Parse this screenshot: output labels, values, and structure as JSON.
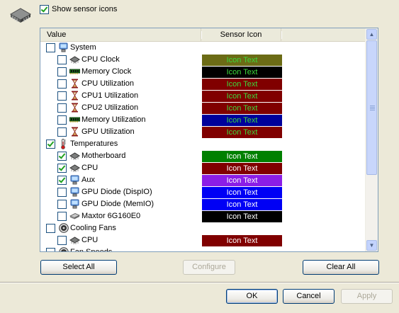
{
  "show_sensor_icons": {
    "label": "Show sensor icons",
    "checked": true
  },
  "list": {
    "columns": [
      "Value",
      "Sensor Icon"
    ],
    "rows": [
      {
        "label": "System",
        "level": 0,
        "checked": false,
        "icon": "computer-icon",
        "swatch": null
      },
      {
        "label": "CPU Clock",
        "level": 1,
        "checked": false,
        "icon": "chip-icon",
        "swatch": {
          "text": "Icon Text",
          "bg": "#6b6b15",
          "fg": "#3cd93c"
        }
      },
      {
        "label": "Memory Clock",
        "level": 1,
        "checked": false,
        "icon": "memory-icon",
        "swatch": {
          "text": "Icon Text",
          "bg": "#000000",
          "fg": "#3cd93c"
        }
      },
      {
        "label": "CPU Utilization",
        "level": 1,
        "checked": false,
        "icon": "hourglass-icon",
        "swatch": {
          "text": "Icon Text",
          "bg": "#800000",
          "fg": "#3cd93c"
        }
      },
      {
        "label": "CPU1 Utilization",
        "level": 1,
        "checked": false,
        "icon": "hourglass-icon",
        "swatch": {
          "text": "Icon Text",
          "bg": "#800000",
          "fg": "#3cd93c"
        }
      },
      {
        "label": "CPU2 Utilization",
        "level": 1,
        "checked": false,
        "icon": "hourglass-icon",
        "swatch": {
          "text": "Icon Text",
          "bg": "#800000",
          "fg": "#3cd93c"
        }
      },
      {
        "label": "Memory Utilization",
        "level": 1,
        "checked": false,
        "icon": "memory-icon",
        "swatch": {
          "text": "Icon Text",
          "bg": "#00009b",
          "fg": "#3cd93c"
        }
      },
      {
        "label": "GPU Utilization",
        "level": 1,
        "checked": false,
        "icon": "hourglass-icon",
        "swatch": {
          "text": "Icon Text",
          "bg": "#800000",
          "fg": "#3cd93c"
        }
      },
      {
        "label": "Temperatures",
        "level": 0,
        "checked": true,
        "icon": "thermometer-icon",
        "swatch": null
      },
      {
        "label": "Motherboard",
        "level": 1,
        "checked": true,
        "icon": "chip-icon",
        "swatch": {
          "text": "Icon Text",
          "bg": "#008000",
          "fg": "#ffffff"
        }
      },
      {
        "label": "CPU",
        "level": 1,
        "checked": true,
        "icon": "chip-icon",
        "swatch": {
          "text": "Icon Text",
          "bg": "#800000",
          "fg": "#ffffff"
        }
      },
      {
        "label": "Aux",
        "level": 1,
        "checked": true,
        "icon": "computer-icon",
        "swatch": {
          "text": "Icon Text",
          "bg": "#8b1ee6",
          "fg": "#ffffff"
        }
      },
      {
        "label": "GPU Diode (DispIO)",
        "level": 1,
        "checked": false,
        "icon": "computer-icon",
        "swatch": {
          "text": "Icon Text",
          "bg": "#0000f5",
          "fg": "#ffffff"
        }
      },
      {
        "label": "GPU Diode (MemIO)",
        "level": 1,
        "checked": false,
        "icon": "computer-icon",
        "swatch": {
          "text": "Icon Text",
          "bg": "#0000f5",
          "fg": "#ffffff"
        }
      },
      {
        "label": "Maxtor 6G160E0",
        "level": 1,
        "checked": false,
        "icon": "hard-drive-icon",
        "swatch": {
          "text": "Icon Text",
          "bg": "#000000",
          "fg": "#ffffff"
        }
      },
      {
        "label": "Cooling Fans",
        "level": 0,
        "checked": false,
        "icon": "fan-icon",
        "swatch": null
      },
      {
        "label": "CPU",
        "level": 1,
        "checked": false,
        "icon": "chip-icon",
        "swatch": {
          "text": "Icon Text",
          "bg": "#800000",
          "fg": "#ffffff"
        }
      },
      {
        "label": "Fan Speeds",
        "level": 0,
        "checked": false,
        "icon": "fan-icon",
        "swatch": null
      }
    ]
  },
  "buttons": {
    "select_all": "Select All",
    "configure": "Configure",
    "clear_all": "Clear All",
    "ok": "OK",
    "cancel": "Cancel",
    "apply": "Apply"
  }
}
